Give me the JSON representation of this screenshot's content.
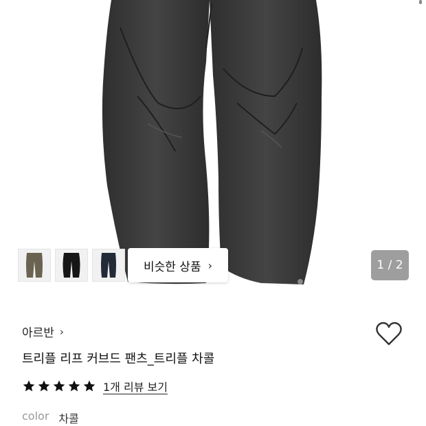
{
  "gallery": {
    "page_indicator": "1 / 2",
    "similar_button_label": "비슷한 상품",
    "thumbnails": [
      {
        "name": "olive-pants"
      },
      {
        "name": "black-pants"
      },
      {
        "name": "navy-pants"
      }
    ]
  },
  "product": {
    "brand": "아르반",
    "title": "트리플 리프 커브드 팬츠_트리플 차콜",
    "rating_stars": 5,
    "review_link": "1개 리뷰 보기",
    "color_label": "color",
    "color_value": "차콜"
  },
  "icons": {
    "brand_chevron": "chevron-right-icon",
    "similar_chevron": "chevron-right-icon",
    "wishlist": "heart-outline-icon",
    "rating": "star-filled-icon"
  },
  "colors": {
    "pants": "#3a3a3a",
    "star": "#111111",
    "pager_bg": "#7a7a7a"
  }
}
